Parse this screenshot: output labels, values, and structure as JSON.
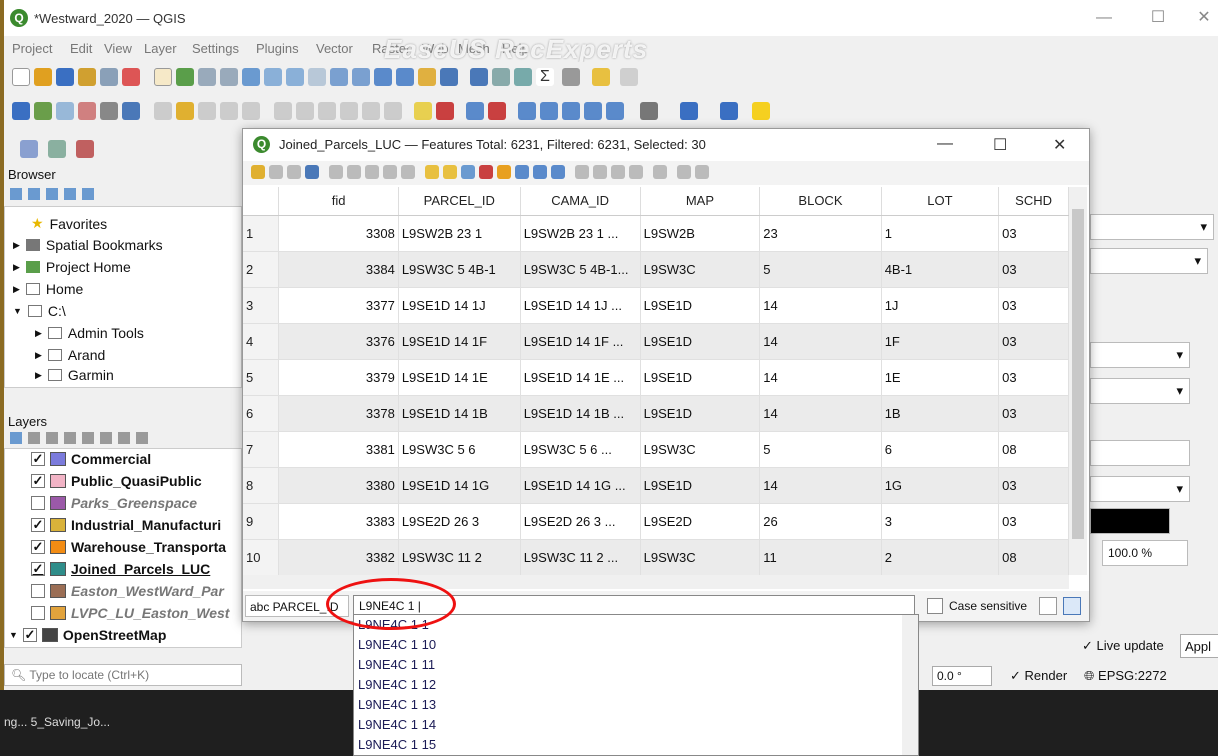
{
  "window": {
    "title": "*Westward_2020 — QGIS"
  },
  "watermark": "EaseUS RecExperts",
  "menu": [
    "Project",
    "Edit",
    "View",
    "Layer",
    "Settings",
    "Plugins",
    "Vector",
    "Raster",
    "Web",
    "Mesh",
    "Help"
  ],
  "browser": {
    "title": "Browser",
    "items": [
      "Favorites",
      "Spatial Bookmarks",
      "Project Home",
      "Home",
      "C:\\",
      "Admin Tools",
      "Arand",
      "Garmin"
    ]
  },
  "layers": {
    "title": "Layers",
    "items": [
      {
        "label": "Commercial",
        "checked": true,
        "color": "#7b7bdc",
        "bold": true
      },
      {
        "label": "Public_QuasiPublic",
        "checked": true,
        "color": "#f2b4c6",
        "bold": true
      },
      {
        "label": "Parks_Greenspace",
        "checked": false,
        "color": "#9b59a8",
        "bold": false
      },
      {
        "label": "Industrial_Manufacturi",
        "checked": true,
        "color": "#d9b23a",
        "bold": true
      },
      {
        "label": "Warehouse_Transporta",
        "checked": true,
        "color": "#f28c14",
        "bold": true
      },
      {
        "label": "Joined_Parcels_LUC",
        "checked": true,
        "color": "#2f8d8a",
        "bold": true
      },
      {
        "label": "Easton_WestWard_Par",
        "checked": false,
        "color": "#9b6e55",
        "bold": false
      },
      {
        "label": "LVPC_LU_Easton_West",
        "checked": false,
        "color": "#e2a33c",
        "bold": false
      },
      {
        "label": "OpenStreetMap",
        "checked": true,
        "color": "#444",
        "bold": true
      }
    ]
  },
  "locator": {
    "placeholder": "Type to locate (Ctrl+K)"
  },
  "attr_table": {
    "title": "Joined_Parcels_LUC — Features Total: 6231, Filtered: 6231, Selected: 30",
    "columns": [
      "fid",
      "PARCEL_ID",
      "CAMA_ID",
      "MAP",
      "BLOCK",
      "LOT",
      "SCHD"
    ],
    "rows": [
      [
        "1",
        "3308",
        "L9SW2B 23 1",
        "L9SW2B 23 1   ...",
        "L9SW2B",
        "23",
        "1",
        "03"
      ],
      [
        "2",
        "3384",
        "L9SW3C 5  4B-1",
        "L9SW3C 5  4B-1...",
        "L9SW3C",
        "5",
        "4B-1",
        "03"
      ],
      [
        "3",
        "3377",
        "L9SE1D 14 1J",
        "L9SE1D 14 1J   ...",
        "L9SE1D",
        "14",
        "1J",
        "03"
      ],
      [
        "4",
        "3376",
        "L9SE1D 14 1F",
        "L9SE1D 14 1F   ...",
        "L9SE1D",
        "14",
        "1F",
        "03"
      ],
      [
        "5",
        "3379",
        "L9SE1D 14 1E",
        "L9SE1D 14 1E   ...",
        "L9SE1D",
        "14",
        "1E",
        "03"
      ],
      [
        "6",
        "3378",
        "L9SE1D 14 1B",
        "L9SE1D 14 1B   ...",
        "L9SE1D",
        "14",
        "1B",
        "03"
      ],
      [
        "7",
        "3381",
        "L9SW3C 5  6",
        "L9SW3C 5  6     ...",
        "L9SW3C",
        "5",
        "6",
        "08"
      ],
      [
        "8",
        "3380",
        "L9SE1D 14 1G",
        "L9SE1D 14 1G   ...",
        "L9SE1D",
        "14",
        "1G",
        "03"
      ],
      [
        "9",
        "3383",
        "L9SE2D 26 3",
        "L9SE2D 26 3     ...",
        "L9SE2D",
        "26",
        "3",
        "03"
      ],
      [
        "10",
        "3382",
        "L9SW3C 11 2",
        "L9SW3C 11 2    ...",
        "L9SW3C",
        "11",
        "2",
        "08"
      ]
    ],
    "filter_field": "abc PARCEL_ID",
    "filter_value": "L9NE4C 1 |",
    "case_sensitive_label": "Case sensitive"
  },
  "suggestions": [
    "L9NE4C 1  1",
    "L9NE4C 1  10",
    "L9NE4C 1  11",
    "L9NE4C 1  12",
    "L9NE4C 1  13",
    "L9NE4C 1  14",
    "L9NE4C 1  15"
  ],
  "right_dock": {
    "opacity": "100.0 %",
    "live_update": "Live update",
    "apply": "Appl"
  },
  "status": {
    "rotation": "0.0 °",
    "render": "Render",
    "crs": "EPSG:2272"
  },
  "taskbar": {
    "item": "ng... 5_Saving_Jo..."
  }
}
